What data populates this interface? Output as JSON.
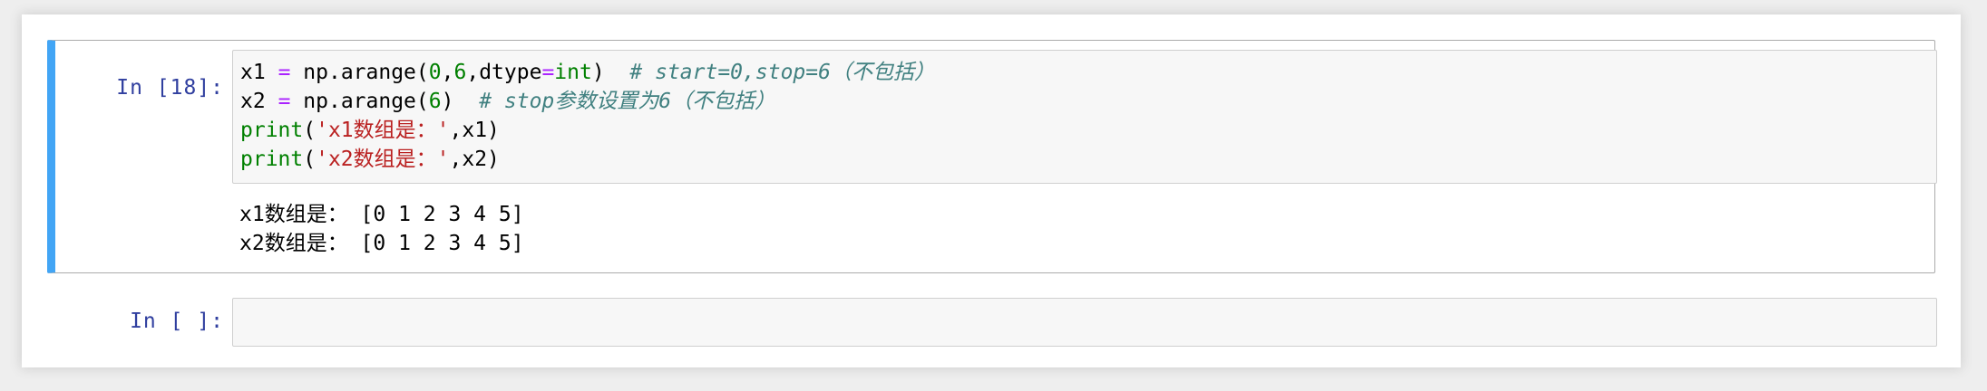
{
  "cells": [
    {
      "prompt": "In [18]:",
      "code": {
        "line1": {
          "var": "x1",
          "eq": "=",
          "pre": "np.arange(",
          "n0": "0",
          "c1": ",",
          "n6": "6",
          "c2": ",dtype",
          "eq2": "=",
          "int": "int",
          "close": ")",
          "comment": "# start=0,stop=6（不包括）"
        },
        "line2": {
          "var": "x2",
          "eq": "=",
          "pre": "np.arange(",
          "n6": "6",
          "close": ")",
          "comment": "# stop参数设置为6（不包括）"
        },
        "line3": {
          "func": "print",
          "open": "(",
          "str": "'x1数组是：'",
          "rest": ",x1)"
        },
        "line4": {
          "func": "print",
          "open": "(",
          "str": "'x2数组是：'",
          "rest": ",x2)"
        }
      },
      "output": [
        "x1数组是： [0 1 2 3 4 5]",
        "x2数组是： [0 1 2 3 4 5]"
      ]
    },
    {
      "prompt": "In [ ]:",
      "code": ""
    }
  ],
  "colors": {
    "selected_cell_bar": "#42a5f5",
    "prompt": "#303f9f",
    "operator": "#aa22ff",
    "number": "#008000",
    "builtin": "#008000",
    "string": "#ba2121",
    "comment": "#408080"
  }
}
